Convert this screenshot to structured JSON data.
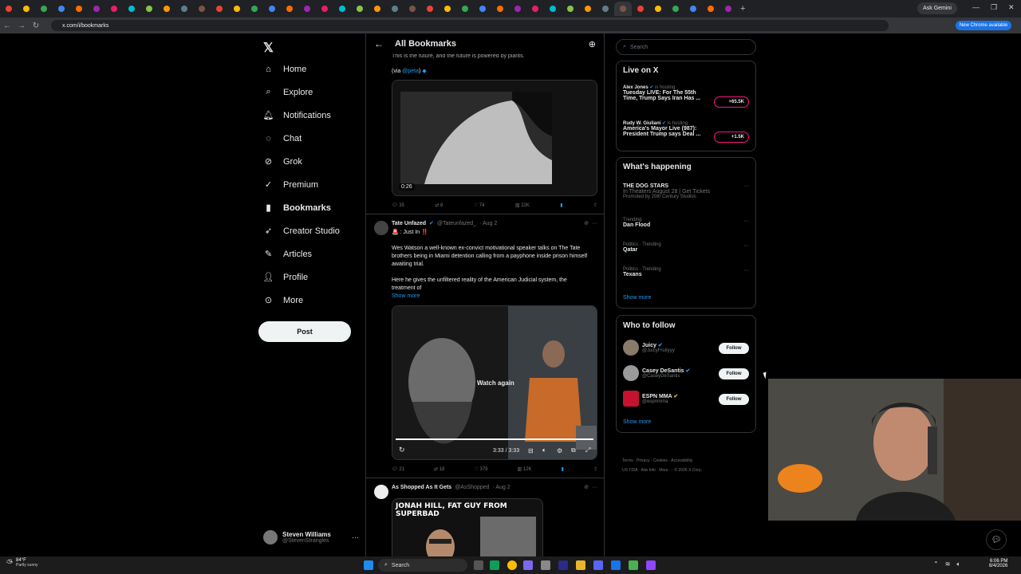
{
  "browser": {
    "tabs_count": 42,
    "ask_gemini": "Ask Gemini",
    "url": "x.com/i/bookmarks",
    "new_chrome": "New Chrome available"
  },
  "nav": {
    "items": [
      "Home",
      "Explore",
      "Notifications",
      "Chat",
      "Grok",
      "Premium",
      "Bookmarks",
      "Creator Studio",
      "Articles",
      "Profile",
      "More"
    ],
    "post_label": "Post",
    "profile_name": "Steven Williams",
    "profile_handle": "@StevenStrangles"
  },
  "feed": {
    "title": "All Bookmarks",
    "t1": {
      "text1": "This is the future, and the future is powered by plants.",
      "via": "(via ",
      "via_link": "@peta",
      "via_end": ")",
      "duration": "0:26",
      "replies": "35",
      "reposts": "8",
      "likes": "74",
      "views": "22K"
    },
    "t2": {
      "name": "Tate Unfazed",
      "handle": "@Tateunfazed_",
      "date": "· Aug 2",
      "line1": "🚨 : Just In ‼️",
      "para1": "Wes Watson a well-known ex-convict motivational speaker talks on The Tate brothers being in Miami detention calling from a payphone inside prison himself awaiting trial.",
      "para2": "Here he gives the unfiltered reality of the American Judicial system, the treatment of",
      "show_more": "Show more",
      "watch_again": "Watch again",
      "time": "3:33 / 3:33",
      "replies": "21",
      "reposts": "18",
      "likes": "379",
      "views": "12K"
    },
    "t3": {
      "name": "As Shopped As It Gets",
      "handle": "@AsShopped",
      "date": "· Aug 2",
      "caption": "JONAH HILL, FAT GUY FROM SUPERBAD"
    }
  },
  "right": {
    "search_placeholder": "Search",
    "live": {
      "title": "Live on X",
      "items": [
        {
          "host": "Alex Jones",
          "status": "is hosting",
          "title1": "Tuesday LIVE: For The 55th",
          "title2": "Time, Trump Says Iran Has ...",
          "count": "+65.5K"
        },
        {
          "host": "Rudy W. Giuliani",
          "status": "is hosting",
          "title1": "America's Mayor Live (987):",
          "title2": "President Trump says Deal ...",
          "count": "+1.5K"
        }
      ]
    },
    "happening": {
      "title": "What's happening",
      "promo_title": "THE DOG STARS",
      "promo_sub": "In Theaters August 28 | Get Tickets",
      "promo_by": "Promoted by 20th Century Studios",
      "trends": [
        {
          "meta": "Trending",
          "name": "Dan Flood"
        },
        {
          "meta": "Politics · Trending",
          "name": "Qatar"
        },
        {
          "meta": "Politics · Trending",
          "name": "Texans"
        }
      ],
      "show_more": "Show more"
    },
    "follow": {
      "title": "Who to follow",
      "people": [
        {
          "name": "Juicy",
          "handle": "@JuicyFruityyy",
          "btn": "Follow"
        },
        {
          "name": "Casey DeSantis",
          "handle": "@CaseyDeSantis",
          "btn": "Follow"
        },
        {
          "name": "ESPN MMA",
          "handle": "@espnmma",
          "btn": "Follow"
        }
      ],
      "show_more": "Show more"
    },
    "footer": {
      "line1": "Terms · Privacy · Cookies · Accessibility",
      "line2": "US TIDA · Ads Info · More ··· © 2026 X Corp."
    }
  },
  "taskbar": {
    "weather_temp": "84°F",
    "weather_desc": "Partly sunny",
    "search": "Search",
    "time": "6:06 PM",
    "date": "8/4/2026"
  }
}
